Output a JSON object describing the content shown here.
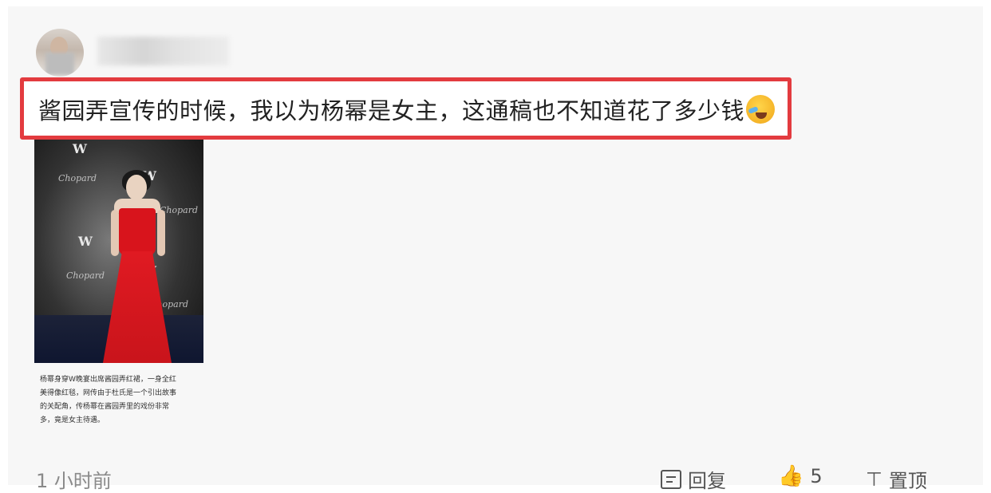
{
  "comment": {
    "text": "酱园弄宣传的时候，我以为杨幂是女主，这通稿也不知道花了多少钱",
    "emoji": "laugh-cry-emoji"
  },
  "photo": {
    "brand_text": "Chopard",
    "logo_text": "W"
  },
  "caption": {
    "lines": [
      "杨幂身穿W晚宴出席酱园弄红裙，一身全红",
      "美得像红毯，网传由于杜氏是一个引出故事",
      "的关配角，传杨幂在酱园弄里的戏份非常",
      "多，竟是女主待遇。"
    ]
  },
  "footer": {
    "time": "1 小时前",
    "reply_label": "回复",
    "like_count": "5",
    "pin_label": "置顶"
  },
  "icons": {
    "reply": "comment-icon",
    "like": "thumbs-up-icon",
    "pin": "pin-top-icon"
  },
  "colors": {
    "highlight_border": "#e33b3f",
    "dress": "#d8141c"
  }
}
